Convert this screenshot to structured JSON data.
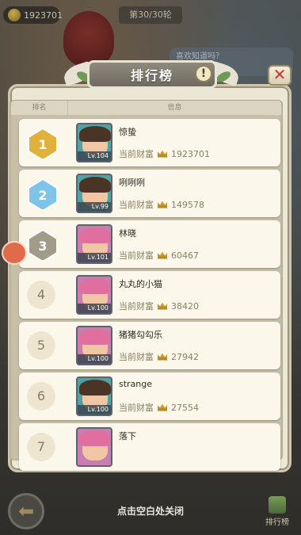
{
  "top_bar": {
    "currency_value": "1923701",
    "round_text": "第30/30轮"
  },
  "background_hint": "喜欢知道吗？",
  "panel": {
    "title": "排行榜",
    "info_icon": "!",
    "close_icon": "✕",
    "header_rank": "排名",
    "header_info": "信息"
  },
  "leaderboard": {
    "wealth_label": "当前财富",
    "rows": [
      {
        "rank": "1",
        "name": "惊蛰",
        "level": "Lv.104",
        "wealth": "1923701",
        "avatar": "brown-hair-male"
      },
      {
        "rank": "2",
        "name": "咧咧咧",
        "level": "Lv.99",
        "wealth": "149578",
        "avatar": "brown-hair-male"
      },
      {
        "rank": "3",
        "name": "林晓",
        "level": "Lv.101",
        "wealth": "60467",
        "avatar": "pink-hair-female"
      },
      {
        "rank": "4",
        "name": "丸丸的小猫",
        "level": "Lv.100",
        "wealth": "38420",
        "avatar": "pink-hair-female"
      },
      {
        "rank": "5",
        "name": "猪猪勾勾乐",
        "level": "Lv.100",
        "wealth": "27942",
        "avatar": "pink-hair-female"
      },
      {
        "rank": "6",
        "name": "strange",
        "level": "Lv.100",
        "wealth": "27554",
        "avatar": "brown-hair-male"
      },
      {
        "rank": "7",
        "name": "落下",
        "level": "",
        "wealth": "",
        "avatar": "pink-hair-female"
      }
    ]
  },
  "bottom": {
    "close_hint": "点击空白处关闭",
    "back_icon": "back-arrow-icon",
    "tab_label": "排行榜"
  },
  "colors": {
    "panel_bg": "#ece6d4",
    "row_bg": "#fbf7ea",
    "gold": "#e0b13c",
    "silver_blue": "#7fc4e8",
    "bronze_grey": "#a39b8a",
    "close_red": "#c0392b"
  }
}
